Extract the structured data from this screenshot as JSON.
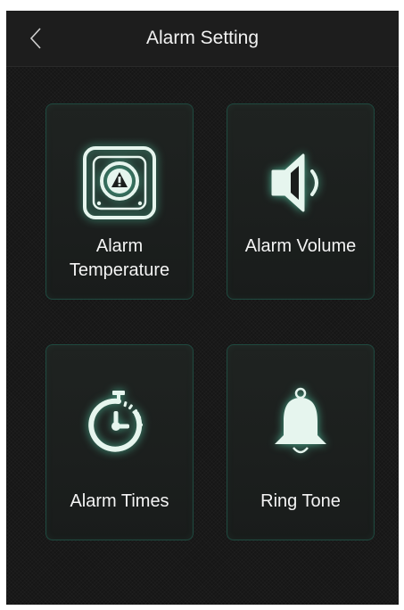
{
  "header": {
    "title": "Alarm Setting",
    "back_icon": "chevron-left-icon"
  },
  "tiles": [
    {
      "label_line1": "Alarm",
      "label_line2": "Temperature",
      "icon": "alarm-temperature-icon"
    },
    {
      "label": "Alarm Volume",
      "icon": "speaker-volume-icon"
    },
    {
      "label": "Alarm Times",
      "icon": "stopwatch-icon"
    },
    {
      "label": "Ring Tone",
      "icon": "bell-icon"
    }
  ],
  "colors": {
    "background": "#161616",
    "tile_border": "#1f4a40",
    "icon_fill": "#e6f5ee",
    "icon_glow": "#5adcb4"
  }
}
